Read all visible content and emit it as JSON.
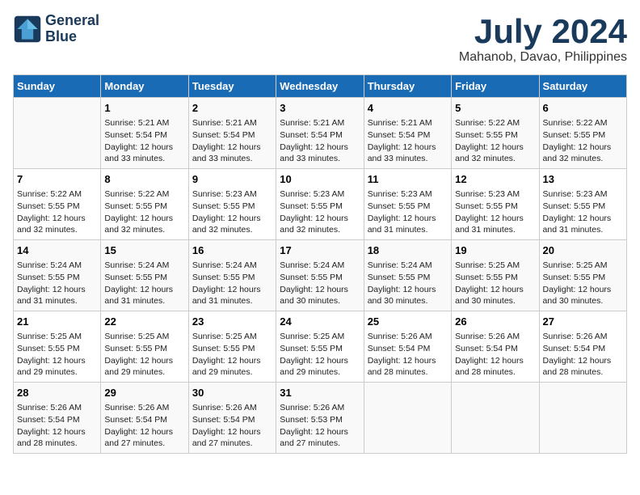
{
  "logo": {
    "line1": "General",
    "line2": "Blue"
  },
  "title": "July 2024",
  "subtitle": "Mahanob, Davao, Philippines",
  "days_header": [
    "Sunday",
    "Monday",
    "Tuesday",
    "Wednesday",
    "Thursday",
    "Friday",
    "Saturday"
  ],
  "weeks": [
    [
      {
        "day": "",
        "info": ""
      },
      {
        "day": "1",
        "info": "Sunrise: 5:21 AM\nSunset: 5:54 PM\nDaylight: 12 hours\nand 33 minutes."
      },
      {
        "day": "2",
        "info": "Sunrise: 5:21 AM\nSunset: 5:54 PM\nDaylight: 12 hours\nand 33 minutes."
      },
      {
        "day": "3",
        "info": "Sunrise: 5:21 AM\nSunset: 5:54 PM\nDaylight: 12 hours\nand 33 minutes."
      },
      {
        "day": "4",
        "info": "Sunrise: 5:21 AM\nSunset: 5:54 PM\nDaylight: 12 hours\nand 33 minutes."
      },
      {
        "day": "5",
        "info": "Sunrise: 5:22 AM\nSunset: 5:55 PM\nDaylight: 12 hours\nand 32 minutes."
      },
      {
        "day": "6",
        "info": "Sunrise: 5:22 AM\nSunset: 5:55 PM\nDaylight: 12 hours\nand 32 minutes."
      }
    ],
    [
      {
        "day": "7",
        "info": "Sunrise: 5:22 AM\nSunset: 5:55 PM\nDaylight: 12 hours\nand 32 minutes."
      },
      {
        "day": "8",
        "info": "Sunrise: 5:22 AM\nSunset: 5:55 PM\nDaylight: 12 hours\nand 32 minutes."
      },
      {
        "day": "9",
        "info": "Sunrise: 5:23 AM\nSunset: 5:55 PM\nDaylight: 12 hours\nand 32 minutes."
      },
      {
        "day": "10",
        "info": "Sunrise: 5:23 AM\nSunset: 5:55 PM\nDaylight: 12 hours\nand 32 minutes."
      },
      {
        "day": "11",
        "info": "Sunrise: 5:23 AM\nSunset: 5:55 PM\nDaylight: 12 hours\nand 31 minutes."
      },
      {
        "day": "12",
        "info": "Sunrise: 5:23 AM\nSunset: 5:55 PM\nDaylight: 12 hours\nand 31 minutes."
      },
      {
        "day": "13",
        "info": "Sunrise: 5:23 AM\nSunset: 5:55 PM\nDaylight: 12 hours\nand 31 minutes."
      }
    ],
    [
      {
        "day": "14",
        "info": "Sunrise: 5:24 AM\nSunset: 5:55 PM\nDaylight: 12 hours\nand 31 minutes."
      },
      {
        "day": "15",
        "info": "Sunrise: 5:24 AM\nSunset: 5:55 PM\nDaylight: 12 hours\nand 31 minutes."
      },
      {
        "day": "16",
        "info": "Sunrise: 5:24 AM\nSunset: 5:55 PM\nDaylight: 12 hours\nand 31 minutes."
      },
      {
        "day": "17",
        "info": "Sunrise: 5:24 AM\nSunset: 5:55 PM\nDaylight: 12 hours\nand 30 minutes."
      },
      {
        "day": "18",
        "info": "Sunrise: 5:24 AM\nSunset: 5:55 PM\nDaylight: 12 hours\nand 30 minutes."
      },
      {
        "day": "19",
        "info": "Sunrise: 5:25 AM\nSunset: 5:55 PM\nDaylight: 12 hours\nand 30 minutes."
      },
      {
        "day": "20",
        "info": "Sunrise: 5:25 AM\nSunset: 5:55 PM\nDaylight: 12 hours\nand 30 minutes."
      }
    ],
    [
      {
        "day": "21",
        "info": "Sunrise: 5:25 AM\nSunset: 5:55 PM\nDaylight: 12 hours\nand 29 minutes."
      },
      {
        "day": "22",
        "info": "Sunrise: 5:25 AM\nSunset: 5:55 PM\nDaylight: 12 hours\nand 29 minutes."
      },
      {
        "day": "23",
        "info": "Sunrise: 5:25 AM\nSunset: 5:55 PM\nDaylight: 12 hours\nand 29 minutes."
      },
      {
        "day": "24",
        "info": "Sunrise: 5:25 AM\nSunset: 5:55 PM\nDaylight: 12 hours\nand 29 minutes."
      },
      {
        "day": "25",
        "info": "Sunrise: 5:26 AM\nSunset: 5:54 PM\nDaylight: 12 hours\nand 28 minutes."
      },
      {
        "day": "26",
        "info": "Sunrise: 5:26 AM\nSunset: 5:54 PM\nDaylight: 12 hours\nand 28 minutes."
      },
      {
        "day": "27",
        "info": "Sunrise: 5:26 AM\nSunset: 5:54 PM\nDaylight: 12 hours\nand 28 minutes."
      }
    ],
    [
      {
        "day": "28",
        "info": "Sunrise: 5:26 AM\nSunset: 5:54 PM\nDaylight: 12 hours\nand 28 minutes."
      },
      {
        "day": "29",
        "info": "Sunrise: 5:26 AM\nSunset: 5:54 PM\nDaylight: 12 hours\nand 27 minutes."
      },
      {
        "day": "30",
        "info": "Sunrise: 5:26 AM\nSunset: 5:54 PM\nDaylight: 12 hours\nand 27 minutes."
      },
      {
        "day": "31",
        "info": "Sunrise: 5:26 AM\nSunset: 5:53 PM\nDaylight: 12 hours\nand 27 minutes."
      },
      {
        "day": "",
        "info": ""
      },
      {
        "day": "",
        "info": ""
      },
      {
        "day": "",
        "info": ""
      }
    ]
  ]
}
